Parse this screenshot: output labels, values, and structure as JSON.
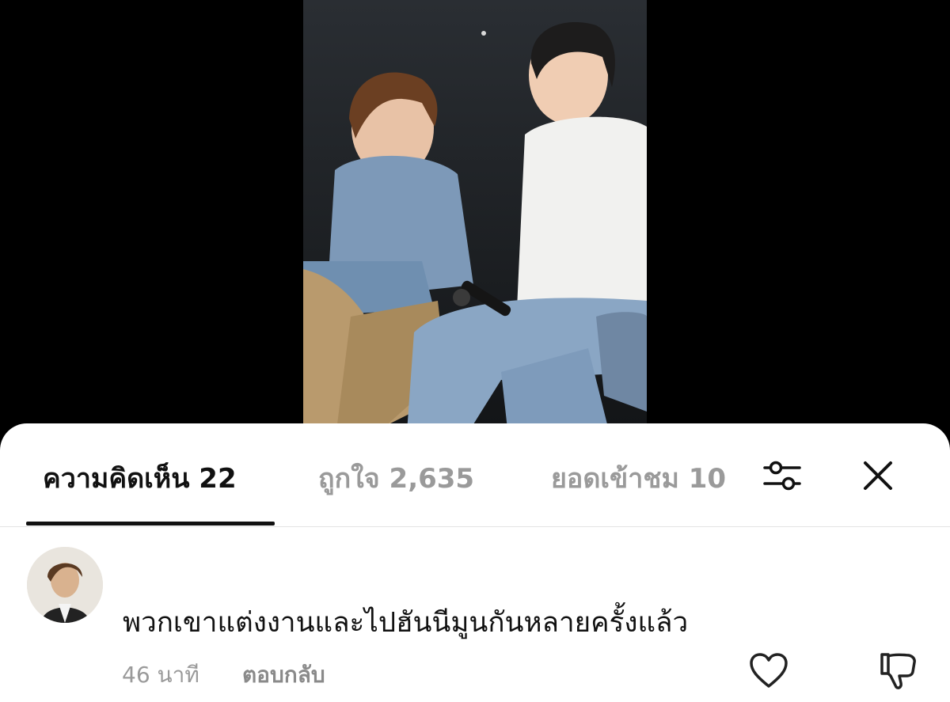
{
  "tabs": {
    "comments": {
      "label": "ความคิดเห็น",
      "count": "22"
    },
    "likes": {
      "label": "ถูกใจ",
      "count": "2,635"
    },
    "views": {
      "label": "ยอดเข้าชม",
      "count": "10"
    }
  },
  "icons": {
    "filter": "sliders-icon",
    "close": "close-icon",
    "like": "heart-icon",
    "dislike": "thumbs-down-icon"
  },
  "comment": {
    "text": "พวกเขาแต่งงานและไปฮันนีมูนกันหลายครั้งแล้ว",
    "time": "46 นาที",
    "reply_label": "ตอบกลับ"
  },
  "colors": {
    "active_tab": "#111111",
    "inactive_tab": "#9a9a9a",
    "sheet_bg": "#ffffff",
    "page_bg": "#000000"
  }
}
